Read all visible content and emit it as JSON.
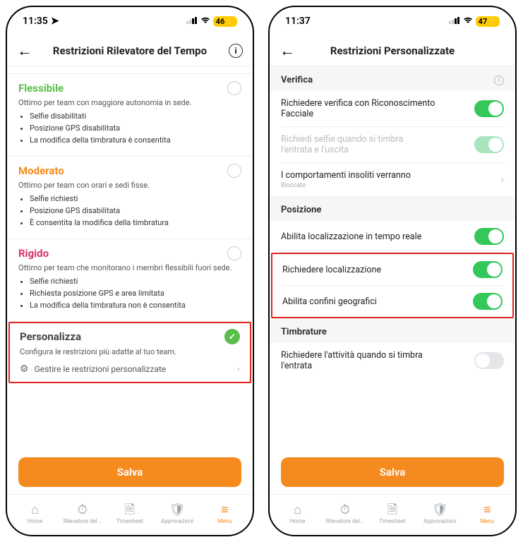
{
  "left": {
    "status": {
      "time": "11:35",
      "battery": "46"
    },
    "header": {
      "title": "Restrizioni Rilevatore del Tempo"
    },
    "options": {
      "flessibile": {
        "title": "Flessibile",
        "subtitle": "Ottimo per team con maggiore autonomia in sede.",
        "b1": "Selfie disabilitati",
        "b2": "Posizione GPS disabilitata",
        "b3": "La modifica della timbratura è consentita"
      },
      "moderato": {
        "title": "Moderato",
        "subtitle": "Ottimo per team con orari e sedi fisse.",
        "b1": "Selfie richiesti",
        "b2": "Posizione GPS disabilitata",
        "b3": "È consentita la modifica della timbratura"
      },
      "rigido": {
        "title": "Rigido",
        "subtitle": "Ottimo per team che monitorano i membri flessibili fuori sede.",
        "b1": "Selfie richiesti",
        "b2": "Richiesta posizione GPS e area limitata",
        "b3": "La modifica della timbratura non è consentita"
      },
      "personalizza": {
        "title": "Personalizza",
        "subtitle": "Configura le restrizioni più adatte al tuo team.",
        "link": "Gestire le restrizioni personalizzate"
      }
    },
    "save": "Salva"
  },
  "right": {
    "status": {
      "time": "11:37",
      "battery": "47"
    },
    "header": {
      "title": "Restrizioni Personalizzate"
    },
    "sections": {
      "verifica": {
        "head": "Verifica",
        "row1": "Richiedere verifica con Riconoscimento Facciale",
        "row2": "Richiedi selfie quando si timbra l'entrata e l'uscita",
        "row3_label": "I comportamenti insoliti verranno",
        "row3_value": "Bloccato"
      },
      "posizione": {
        "head": "Posizione",
        "row1": "Abilita localizzazione in tempo reale",
        "row2": "Richiedere localizzazione",
        "row3": "Abilita confini geografici"
      },
      "timbrature": {
        "head": "Timbrature",
        "row1": "Richiedere l'attività quando si timbra l'entrata"
      }
    },
    "save": "Salva"
  },
  "tabs": {
    "home": "Home",
    "rilevatore": "Rilevatore del...",
    "timesheet": "Timesheet",
    "approvazioni": "Approvazioni",
    "menu": "Menu"
  }
}
